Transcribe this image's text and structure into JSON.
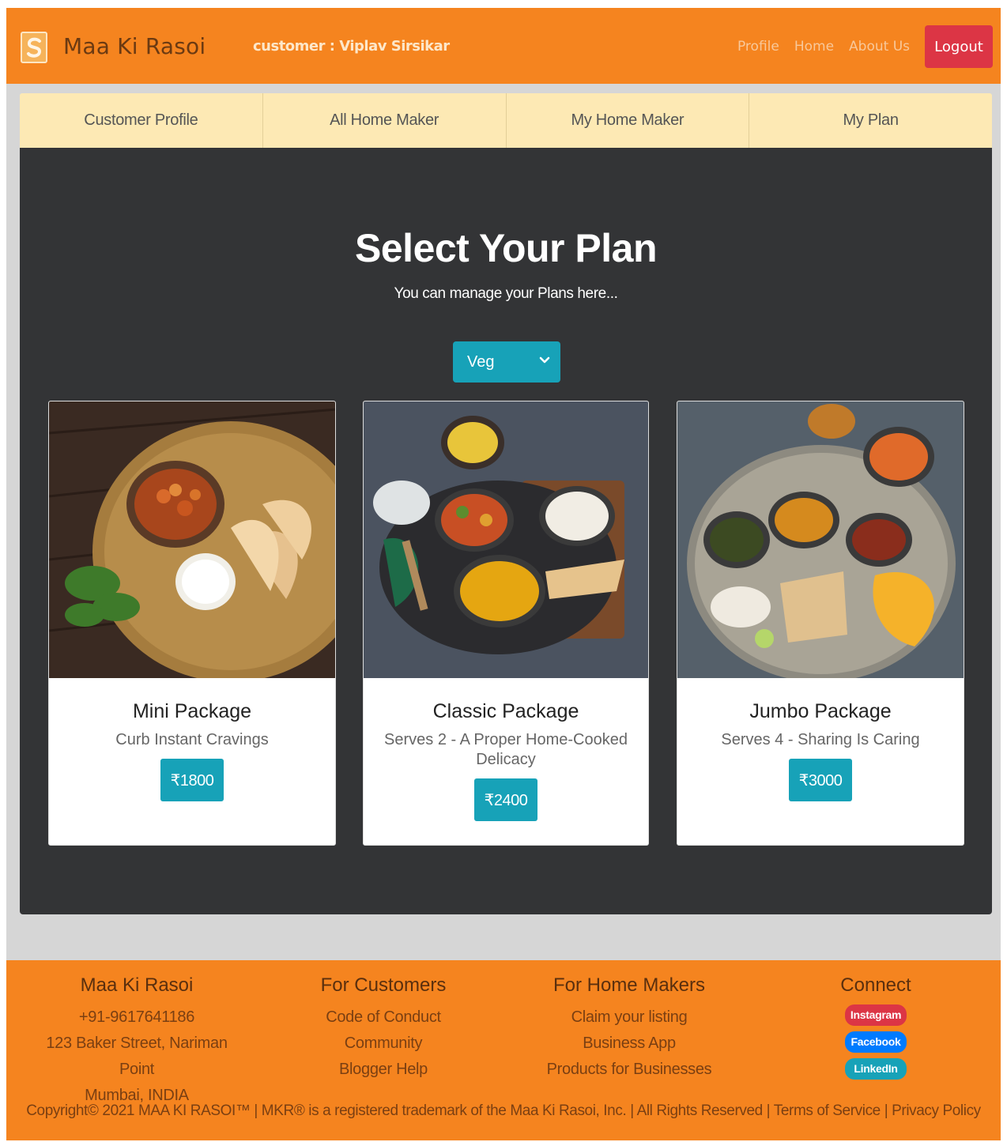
{
  "navbar": {
    "brand": "Maa Ki Rasoi",
    "customer": "customer : Viplav Sirsikar",
    "links": [
      "Profile",
      "Home",
      "About Us"
    ],
    "logout": "Logout"
  },
  "tabs": [
    "Customer Profile",
    "All Home Maker",
    "My Home Maker",
    "My Plan"
  ],
  "main": {
    "title": "Select Your Plan",
    "subtitle": "You can manage your Plans here...",
    "select_value": "Veg"
  },
  "plans": [
    {
      "name": "Mini Package",
      "desc": "Curb Instant Cravings",
      "price": "₹1800"
    },
    {
      "name": "Classic Package",
      "desc": "Serves 2 - A Proper Home-Cooked Delicacy",
      "price": "₹2400"
    },
    {
      "name": "Jumbo Package",
      "desc": "Serves 4 - Sharing Is Caring",
      "price": "₹3000"
    }
  ],
  "footer": {
    "col1": {
      "title": "Maa Ki Rasoi",
      "lines": [
        "+91-9617641186",
        "123 Baker Street, Nariman Point",
        "Mumbai, INDIA"
      ]
    },
    "col2": {
      "title": "For Customers",
      "lines": [
        "Code of Conduct",
        "Community",
        "Blogger Help"
      ]
    },
    "col3": {
      "title": "For Home Makers",
      "lines": [
        "Claim your listing",
        "Business App",
        "Products for Businesses"
      ]
    },
    "col4": {
      "title": "Connect",
      "badges": [
        "Instagram",
        "Facebook",
        "LinkedIn"
      ]
    },
    "copyright": "Copyright© 2021 MAA KI RASOI™ | MKR® is a registered trademark of the Maa Ki Rasoi, Inc. | All Rights Reserved | Terms of Service | Privacy Policy"
  },
  "colors": {
    "primary_orange": "#f5841f",
    "teal": "#17a2b8",
    "danger": "#dc3545",
    "panel_dark": "#333436",
    "tab_bg": "#fde9b4"
  }
}
